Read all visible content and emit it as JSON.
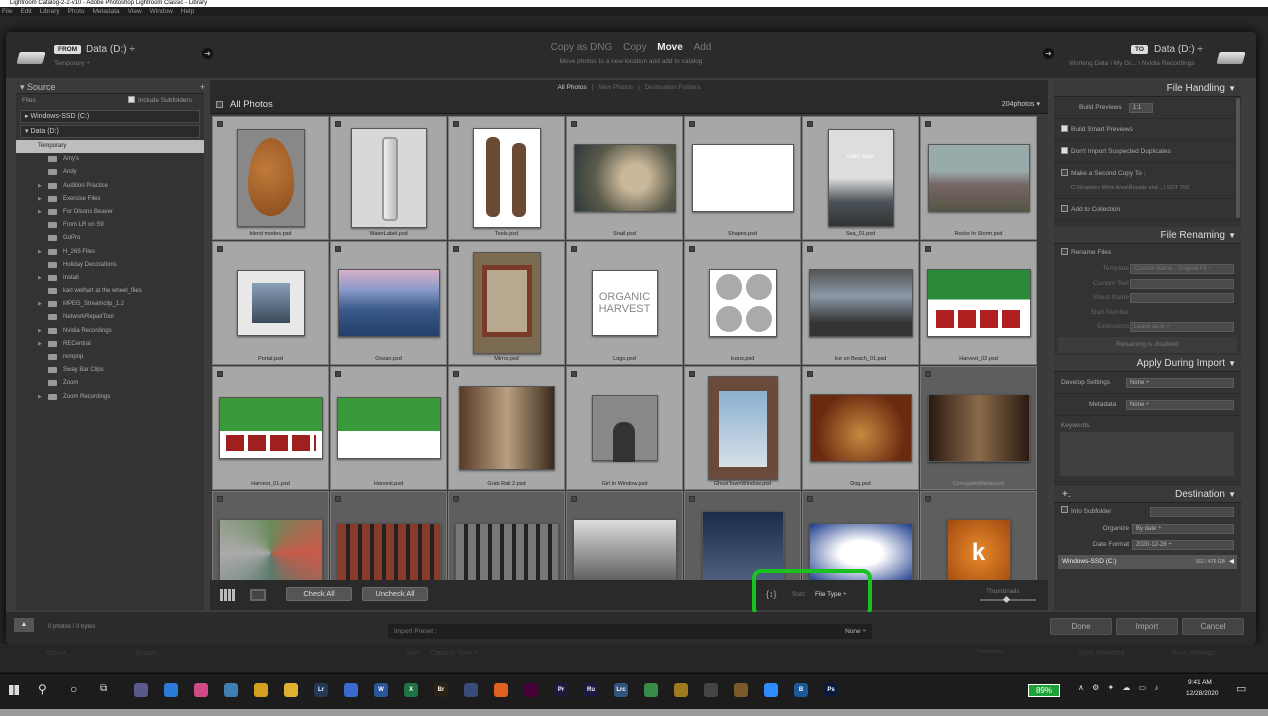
{
  "window": {
    "title": "Lightroom Catalog-2-2-v10 - Adobe Photoshop Lightroom Classic - Library"
  },
  "menu": [
    "File",
    "Edit",
    "Library",
    "Photo",
    "Metadata",
    "View",
    "Window",
    "Help"
  ],
  "topbar": {
    "from_tag": "FROM",
    "from_volume": "Data (D:) ÷",
    "from_sub": "Temporary ÷",
    "modes": [
      "Copy as DNG",
      "Copy",
      "Move",
      "Add"
    ],
    "active_mode": "Move",
    "mode_desc": "Move photos to a new location and add to catalog",
    "to_tag": "TO",
    "to_volume": "Data (D:) ÷",
    "to_sub": "Working Data \\ My Gr... \\ Nvidia Recordings"
  },
  "source": {
    "title": "Source",
    "files_label": "Files",
    "include_subfolders": "Include Subfolders",
    "drive1": "Windows-SSD (C:)",
    "drive2": "Data (D:)",
    "selected": "Temporary",
    "folders": [
      {
        "name": "Amy's",
        "expandable": false
      },
      {
        "name": "Andy",
        "expandable": false
      },
      {
        "name": "Audition Practice",
        "expandable": true
      },
      {
        "name": "Exercise Files",
        "expandable": true
      },
      {
        "name": "For Olsons Beaver",
        "expandable": true
      },
      {
        "name": "From LR on S9",
        "expandable": false
      },
      {
        "name": "GoPro",
        "expandable": false
      },
      {
        "name": "H_265 Files",
        "expandable": true
      },
      {
        "name": "Holiday Decorations",
        "expandable": false
      },
      {
        "name": "Install",
        "expandable": true
      },
      {
        "name": "karl welhart at the wheel_files",
        "expandable": false
      },
      {
        "name": "MPEG_Streamclip_1.2",
        "expandable": true
      },
      {
        "name": "NetworkRepairTool",
        "expandable": false
      },
      {
        "name": "Nvidia Recordings",
        "expandable": true
      },
      {
        "name": "RECentral",
        "expandable": true
      },
      {
        "name": "rempnp",
        "expandable": false
      },
      {
        "name": "Sway Bar Clips",
        "expandable": false
      },
      {
        "name": "Zoom",
        "expandable": false
      },
      {
        "name": "Zoom Recordings",
        "expandable": true
      }
    ]
  },
  "center": {
    "tabs": [
      "All Photos",
      "New Photos",
      "Destination Folders"
    ],
    "active_tab": "All Photos",
    "header": "All Photos",
    "count": "204photos",
    "photos": [
      {
        "name": "blend modes.psd",
        "checked": true
      },
      {
        "name": "WaterLabel.psd",
        "checked": true
      },
      {
        "name": "Tools.psd",
        "checked": true
      },
      {
        "name": "Snail.psd",
        "checked": true
      },
      {
        "name": "Shapes.psd",
        "checked": true
      },
      {
        "name": "Sea_01.psd",
        "checked": true
      },
      {
        "name": "Rocks In Storm.psd",
        "checked": true
      },
      {
        "name": "Portal.psd",
        "checked": true
      },
      {
        "name": "Ocean.psd",
        "checked": true
      },
      {
        "name": "Mirror.psd",
        "checked": true
      },
      {
        "name": "Logo.psd",
        "checked": true
      },
      {
        "name": "Icons.psd",
        "checked": true
      },
      {
        "name": "Ice on Beach_01.psd",
        "checked": true
      },
      {
        "name": "Harvest_02.psd",
        "checked": true
      },
      {
        "name": "Harvest_01.psd",
        "checked": true
      },
      {
        "name": "Harvest.psd",
        "checked": true
      },
      {
        "name": "Grab Rail 2.psd",
        "checked": true
      },
      {
        "name": "Girl In Window.psd",
        "checked": true
      },
      {
        "name": "GhostTownWindow.psd",
        "checked": true
      },
      {
        "name": "Dog.psd",
        "checked": true
      },
      {
        "name": "CorrugatedMetal.psd",
        "checked": false
      },
      {
        "name": "",
        "checked": false
      },
      {
        "name": "",
        "checked": false
      },
      {
        "name": "",
        "checked": false
      },
      {
        "name": "",
        "checked": false
      },
      {
        "name": "",
        "checked": false
      },
      {
        "name": "",
        "checked": false
      },
      {
        "name": "",
        "checked": false
      }
    ],
    "logo_text1": "ORGANIC",
    "logo_text2": "HARVEST",
    "sea_text": "calm seas",
    "k_letter": "k",
    "check_all": "Check All",
    "uncheck_all": "Uncheck All",
    "sort_label": "Sort:",
    "sort_value": "File Type ÷",
    "thumbnails_label": "Thumbnails"
  },
  "file_handling": {
    "title": "File Handling",
    "build_previews_label": "Build Previews",
    "build_previews_value": "1:1",
    "smart_previews": "Build Smart Previews",
    "dont_import_dupes": "Don't Import Suspected Duplicates",
    "second_copy": "Make a Second Copy To :",
    "second_copy_path": "C:\\Graphics Work Area\\Rosalie and ...\\ SOT 750",
    "add_collection": "Add to Collection"
  },
  "file_renaming": {
    "title": "File Renaming",
    "rename_files": "Rename Files",
    "template_label": "Template",
    "template_value": "Custom Name - Original Fil ÷",
    "custom_text": "Custom Text",
    "shoot_name": "Shoot Name",
    "start_number": "Start Number",
    "extensions_label": "Extensions",
    "extensions_value": "Leave as-is ÷",
    "disabled": "Renaming is disabled"
  },
  "apply_during_import": {
    "title": "Apply During Import",
    "develop_label": "Develop Settings",
    "develop_value": "None ÷",
    "metadata_label": "Metadata",
    "metadata_value": "None ÷",
    "keywords_label": "Keywords"
  },
  "destination": {
    "title": "Destination",
    "into_subfolder": "Into Subfolder",
    "organize_label": "Organize",
    "organize_value": "By date ÷",
    "date_format_label": "Date Format",
    "date_format_value": "2020-12-28 ÷",
    "volume": "Windows-SSD (C:)",
    "volume_space": "162 / 476 GB"
  },
  "footer": {
    "photos_info": "0 photos / 0 bytes",
    "preset_label": "Import Preset :",
    "preset_value": "None ÷",
    "done": "Done",
    "import": "Import",
    "cancel": "Cancel"
  },
  "ghost": {
    "import": "Import...",
    "export": "Export...",
    "sort": "Sort:",
    "sort_value": "Capture Time ÷",
    "sync_metadata": "Sync Metadata",
    "sync_settings": "Sync Settings",
    "thumbnails": "Thumbnails"
  },
  "taskbar": {
    "apps": [
      {
        "icon": "widgets-icon",
        "label": "",
        "color": "#5a5a8a"
      },
      {
        "icon": "lightroom-mobile-icon",
        "label": "",
        "color": "#2a7bd8"
      },
      {
        "icon": "photos-icon",
        "label": "",
        "color": "#d04a8a"
      },
      {
        "icon": "paint-icon",
        "label": "",
        "color": "#3d7fb0"
      },
      {
        "icon": "chrome-icon",
        "label": "",
        "color": "#d4a020"
      },
      {
        "icon": "file-explorer-icon",
        "label": "",
        "color": "#e0b030"
      },
      {
        "icon": "lightroom-classic-icon",
        "label": "Lr",
        "color": "#223a55"
      },
      {
        "icon": "dropper-icon",
        "label": "",
        "color": "#3a6ad0"
      },
      {
        "icon": "word-icon",
        "label": "W",
        "color": "#2b579a"
      },
      {
        "icon": "excel-icon",
        "label": "X",
        "color": "#217346"
      },
      {
        "icon": "bridge-icon",
        "label": "Br",
        "color": "#2a2212"
      },
      {
        "icon": "vpn-icon",
        "label": "",
        "color": "#3a4a7a"
      },
      {
        "icon": "firefox-icon",
        "label": "",
        "color": "#e06020"
      },
      {
        "icon": "xd-icon",
        "label": "",
        "color": "#470137"
      },
      {
        "icon": "premiere-icon",
        "label": "Pr",
        "color": "#1e1a3e"
      },
      {
        "icon": "rush-icon",
        "label": "Ru",
        "color": "#1a1a40"
      },
      {
        "icon": "lrc-active-icon",
        "label": "Lrc",
        "color": "#31567c"
      },
      {
        "icon": "globe-icon",
        "label": "",
        "color": "#3a8a4a"
      },
      {
        "icon": "speaker-icon",
        "label": "",
        "color": "#a07a20"
      },
      {
        "icon": "obs-icon",
        "label": "",
        "color": "#444"
      },
      {
        "icon": "game-icon",
        "label": "",
        "color": "#7a5a2a"
      },
      {
        "icon": "zoom-icon",
        "label": "",
        "color": "#2d8cff"
      },
      {
        "icon": "bing-icon",
        "label": "B",
        "color": "#1a5a9a"
      },
      {
        "icon": "photoshop-icon",
        "label": "Ps",
        "color": "#0a1a3a"
      }
    ],
    "battery": "89%",
    "time": "9:41 AM",
    "date": "12/28/2020"
  }
}
